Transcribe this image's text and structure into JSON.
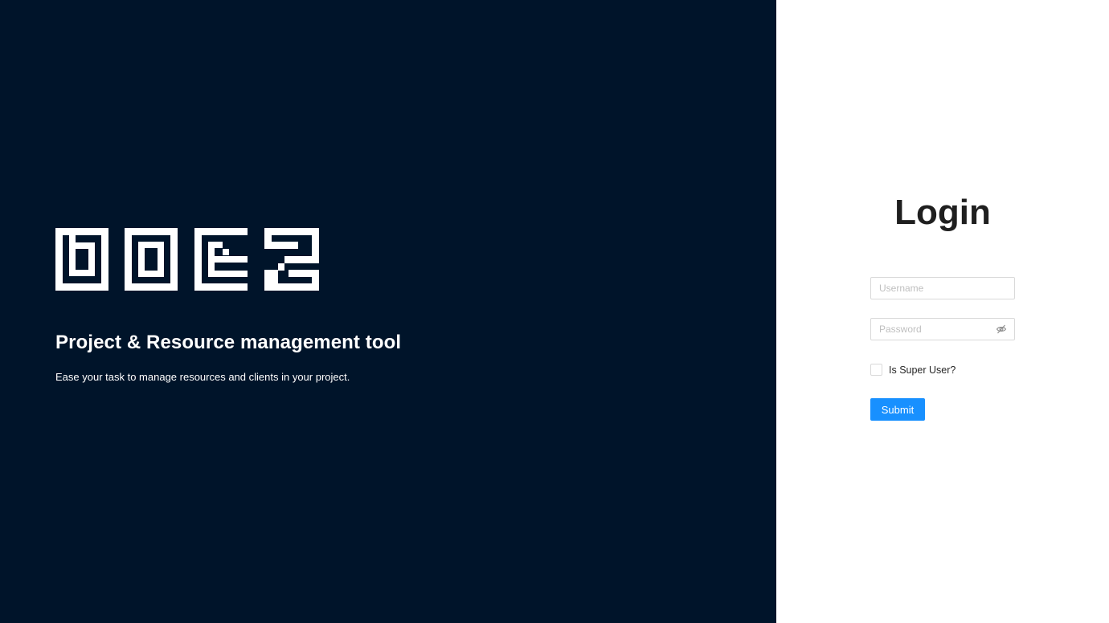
{
  "branding": {
    "logo_text": "DOEZ",
    "tagline": "Project & Resource management tool",
    "description": "Ease your task to manage resources and clients in your project."
  },
  "login": {
    "title": "Login",
    "username": {
      "value": "",
      "placeholder": "Username"
    },
    "password": {
      "value": "",
      "placeholder": "Password",
      "toggle_icon": "eye-invisible-icon"
    },
    "super_user_checkbox": {
      "label": "Is Super User?",
      "checked": false
    },
    "submit_label": "Submit"
  },
  "colors": {
    "left_background": "#00142a",
    "right_background": "#ffffff",
    "accent": "#1890ff"
  }
}
